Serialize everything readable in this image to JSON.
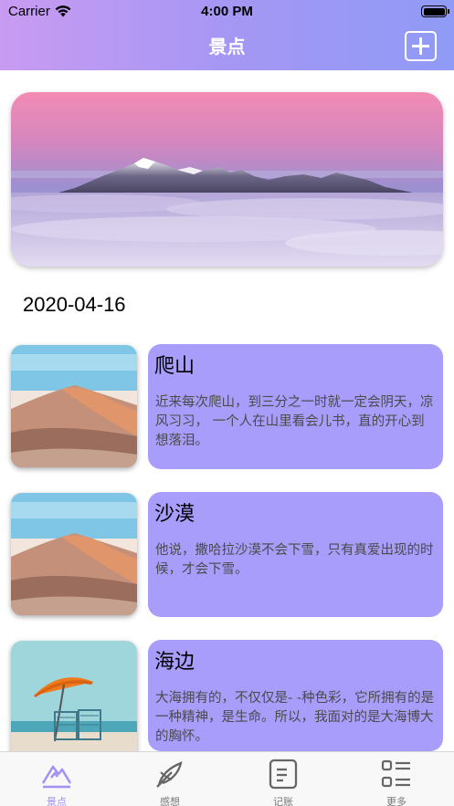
{
  "status_bar": {
    "carrier": "Carrier",
    "time": "4:00 PM"
  },
  "header": {
    "title": "景点",
    "add_icon": "plus-square-icon"
  },
  "date": "2020-04-16",
  "entries": [
    {
      "title": "爬山",
      "body": "近来每次爬山，到三分之一时就一定会阴天，凉风习习， 一个人在山里看会儿书，直的开心到想落泪。",
      "image": "desert-dunes"
    },
    {
      "title": "沙漠",
      "body": "他说，撒哈拉沙漠不会下雪，只有真爱出现的时候，才会下雪。",
      "image": "desert-dunes"
    },
    {
      "title": "海边",
      "body": "大海拥有的，不仅仅是- -种色彩，它所拥有的是一种精神，是生命。所以，我面对的是大海博大的胸怀。",
      "image": "beach-umbrella"
    }
  ],
  "tabs": [
    {
      "label": "景点",
      "icon": "mountain-icon",
      "active": true
    },
    {
      "label": "感想",
      "icon": "feather-icon",
      "active": false
    },
    {
      "label": "记账",
      "icon": "ledger-icon",
      "active": false
    },
    {
      "label": "更多",
      "icon": "grid-list-icon",
      "active": false
    }
  ],
  "colors": {
    "header_start": "#c99bf2",
    "header_end": "#8f9bf6",
    "card_bg": "#a89dfb",
    "active_tab": "#a490f5"
  }
}
